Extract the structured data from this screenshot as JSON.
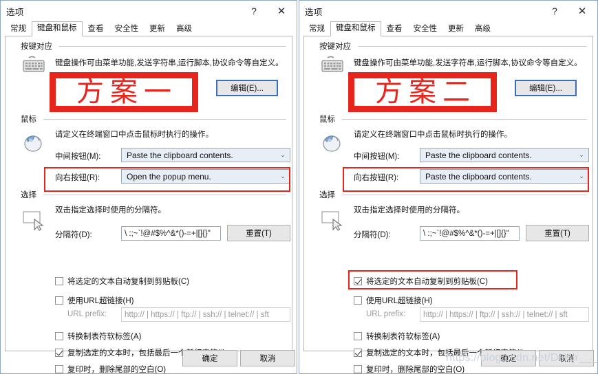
{
  "window": {
    "title": "选项",
    "help_label": "?",
    "close_label": "✕"
  },
  "tabs": [
    {
      "label": "常规",
      "active": false
    },
    {
      "label": "键盘和鼠标",
      "active": true
    },
    {
      "label": "查看",
      "active": false
    },
    {
      "label": "安全性",
      "active": false
    },
    {
      "label": "更新",
      "active": false
    },
    {
      "label": "高级",
      "active": false
    }
  ],
  "groups": {
    "keyboard": {
      "title": "按键对应",
      "description": "键盘操作可由菜单功能,发送字符串,运行脚本,协议命令等自定义。",
      "edit_button": "编辑(E)...",
      "icon": "keyboard-icon"
    },
    "mouse": {
      "title": "鼠标",
      "description": "请定义在终端窗口中点击鼠标时执行的操作。",
      "icon": "mouse-icon",
      "middle_button_label": "中间按钮(M):",
      "right_button_label": "向右按钮(R):"
    },
    "selection": {
      "title": "选择",
      "description": "双击指定选择时使用的分隔符。",
      "icon": "selection-icon",
      "separator_label": "分隔符(D):",
      "separator_value": "\\ :;~`!@#$%^&*()-=+|[]{}\"",
      "reset_button": "重置(T)"
    }
  },
  "checkboxes": {
    "auto_copy": "将选定的文本自动复制到剪贴板(C)",
    "url_hyperlink": "使用URL超链接(H)",
    "url_prefix_label": "URL prefix:",
    "url_prefix_value": "http:// | https:// | ftp:// | ssh:// | telnet:// | sft",
    "convert_tab": "转换制表符软标签(A)",
    "include_newline": "复制选定的文本时，包括最后一个新行字符(I)",
    "trim_trailing": "复印时，删除尾部的空白(O)"
  },
  "footer": {
    "ok": "确定",
    "cancel": "取消"
  },
  "left_dialog": {
    "annotation": "方案一",
    "mouse_middle_value": "Paste the clipboard contents.",
    "mouse_right_value": "Open the popup menu.",
    "auto_copy_checked": false,
    "url_hyperlink_checked": false,
    "convert_tab_checked": false,
    "include_newline_checked": true,
    "trim_trailing_checked": false
  },
  "right_dialog": {
    "annotation": "方案二",
    "mouse_middle_value": "Paste the clipboard contents.",
    "mouse_right_value": "Paste the clipboard contents.",
    "auto_copy_checked": true,
    "url_hyperlink_checked": false,
    "convert_tab_checked": false,
    "include_newline_checked": true,
    "trim_trailing_checked": false
  },
  "watermark": "https://blog.csdn.net/DHsjr___",
  "colors": {
    "annotation_red": "#e8251d",
    "focus_blue": "#3a6fb5",
    "combo_bg": "#e8eef5",
    "window_border": "#8ea6c8"
  }
}
